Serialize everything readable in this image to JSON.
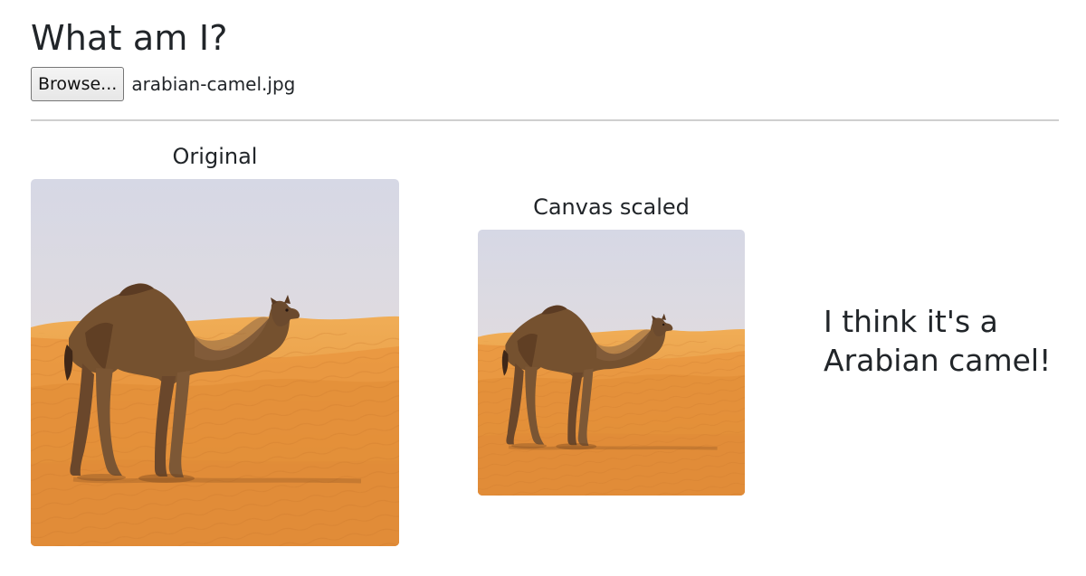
{
  "page": {
    "title": "What am I?"
  },
  "file_input": {
    "button_label": "Browse...",
    "file_name": "arabian-camel.jpg"
  },
  "images": {
    "original": {
      "caption": "Original",
      "subject": "camel-standing-in-desert"
    },
    "scaled": {
      "caption": "Canvas scaled",
      "subject": "camel-standing-in-desert"
    }
  },
  "prediction": {
    "text": "I think it's a Arabian camel!"
  },
  "colors": {
    "sky_top": "#d6d8e5",
    "sky_bottom": "#ecdfd8",
    "sand_light": "#f0ad56",
    "sand_mid": "#e69640",
    "sand_dark": "#d87c2d",
    "camel_body": "#75512f",
    "camel_dark": "#3f2718",
    "camel_light": "#9a7650"
  }
}
